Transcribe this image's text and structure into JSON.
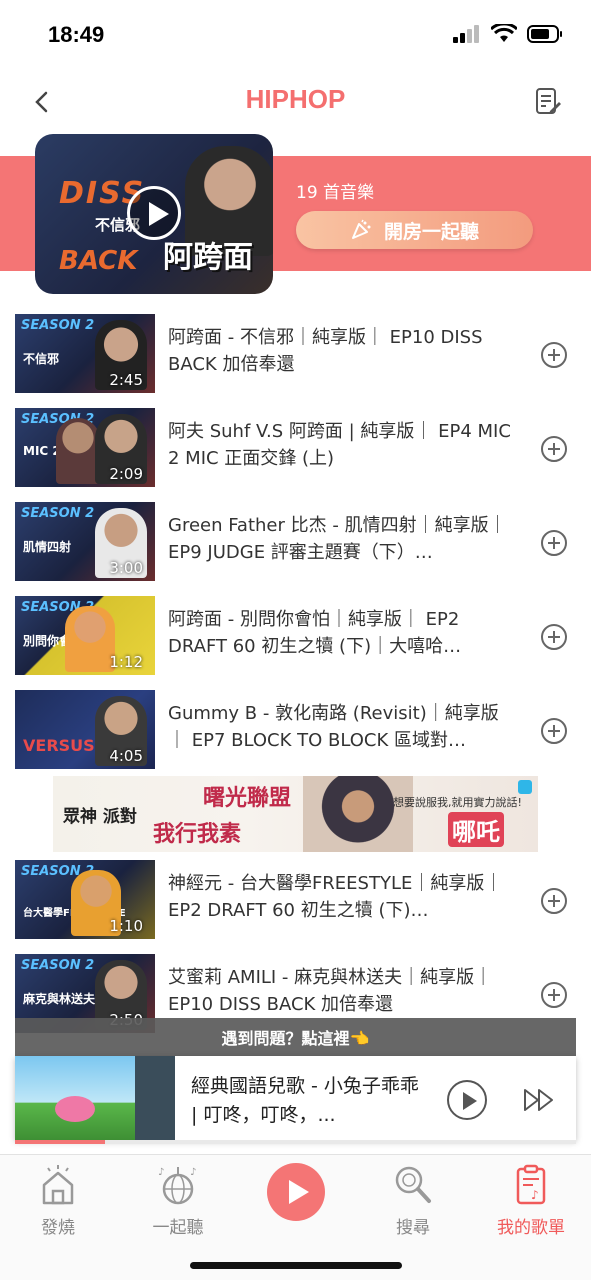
{
  "status": {
    "time": "18:49"
  },
  "header": {
    "title": "HIPHOP",
    "back_icon": "chevron-left-icon",
    "edit_icon": "edit-note-icon"
  },
  "playlist": {
    "count_label": "19 首音樂",
    "open_room_label": "開房一起聽",
    "cover_text": {
      "diss": "DISS",
      "subtitle": "不信邪",
      "back": "BACK",
      "name": "阿跨面"
    }
  },
  "songs": [
    {
      "title": "阿跨面 - 不信邪｜純享版｜ EP10 DISS BACK 加倍奉還",
      "duration": "2:45",
      "caption": "不信邪"
    },
    {
      "title": "阿夫 Suhf V.S 阿跨面 | 純享版｜ EP4 MIC 2 MIC 正面交鋒 (上)",
      "duration": "2:09",
      "caption": "MIC 2 MIC"
    },
    {
      "title": "Green Father 比杰 - 肌情四射｜純享版｜ EP9 JUDGE 評審主題賽（下）…",
      "duration": "3:00",
      "caption": "肌情四射"
    },
    {
      "title": "阿跨面 - 別問你會怕｜純享版｜ EP2 DRAFT 60 初生之犢 (下)｜大嘻哈…",
      "duration": "1:12",
      "caption": "別問你會怕"
    },
    {
      "title": "Gummy B - 敦化南路 (Revisit)｜純享版｜ EP7 BLOCK TO BLOCK 區域對…",
      "duration": "4:05",
      "caption": "VERSUS"
    },
    {
      "title": "神經元 - 台大醫學FREESTYLE｜純享版｜ EP2 DRAFT 60 初生之犢 (下)…",
      "duration": "1:10",
      "caption": "台大醫學FREESTYLE"
    },
    {
      "title": "艾蜜莉 AMILI - 麻克與林送夫｜純享版｜ EP10 DISS BACK 加倍奉還",
      "duration": "2:50",
      "caption": "麻克與林送夫"
    }
  ],
  "ad": {
    "line1": "眾神 派對",
    "line2": "曙光聯盟",
    "line3": "我行我素",
    "line4": "想要說服我,就用實力說話!",
    "line5": "哪吒"
  },
  "problem_bar": {
    "label": "遇到問題？點這裡👈"
  },
  "player": {
    "title": "經典國語兒歌 - 小兔子乖乖 | 叮咚，叮咚，...",
    "progress": 0.16
  },
  "tabs": [
    {
      "label": "發燒",
      "icon": "home-fire-icon"
    },
    {
      "label": "一起聽",
      "icon": "disco-ball-icon"
    },
    {
      "label": "",
      "icon": "play-center-icon"
    },
    {
      "label": "搜尋",
      "icon": "search-icon"
    },
    {
      "label": "我的歌單",
      "icon": "playlist-icon",
      "active": true
    }
  ],
  "colors": {
    "accent": "#f47575",
    "title": "#f46f6f",
    "active_tab": "#f05a5a"
  }
}
